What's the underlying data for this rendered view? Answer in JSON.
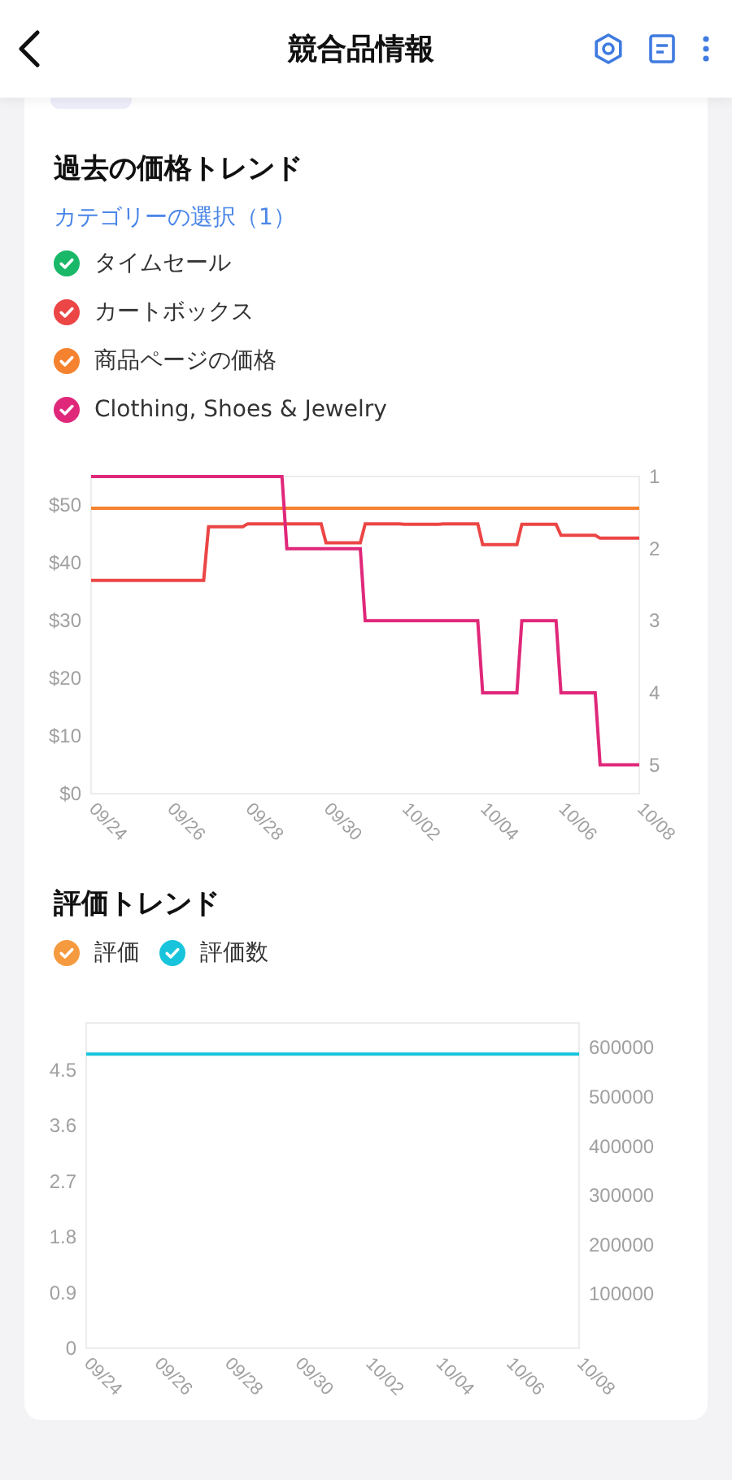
{
  "header": {
    "title": "競合品情報"
  },
  "sections": [
    {
      "title": "過去の価格トレンド",
      "link": "カテゴリーの選択（1）",
      "legend": [
        {
          "label": "タイムセール",
          "checked": true,
          "color": "#19b868"
        },
        {
          "label": "カートボックス",
          "checked": true,
          "color": "#ec4545"
        },
        {
          "label": "商品ページの価格",
          "checked": true,
          "color": "#f5822e"
        },
        {
          "label": "Clothing, Shoes & Jewelry",
          "checked": true,
          "color": "#e0287a"
        }
      ],
      "chart_data": {
        "type": "line",
        "categories": [
          "09/24",
          null,
          null,
          null,
          null,
          null,
          null,
          null,
          null,
          null,
          null,
          null,
          null,
          null,
          null,
          null,
          "09/26",
          null,
          null,
          null,
          null,
          null,
          null,
          null,
          null,
          null,
          null,
          null,
          null,
          null,
          null,
          null,
          "09/28",
          null,
          null,
          null,
          null,
          null,
          null,
          null,
          null,
          null,
          null,
          null,
          null,
          null,
          null,
          null,
          "09/30",
          null,
          null,
          null,
          null,
          null,
          null,
          null,
          null,
          null,
          null,
          null,
          null,
          null,
          null,
          null,
          "10/02",
          null,
          null,
          null,
          null,
          null,
          null,
          null,
          null,
          null,
          null,
          null,
          null,
          null,
          null,
          null,
          "10/04",
          null,
          null,
          null,
          null,
          null,
          null,
          null,
          null,
          null,
          null,
          null,
          null,
          null,
          null,
          null,
          "10/06",
          null,
          null,
          null,
          null,
          null,
          null,
          null,
          null,
          null,
          null,
          null,
          null,
          null,
          null,
          null,
          "10/08"
        ],
        "ylim": [
          0,
          55
        ],
        "yticks": [
          {
            "value": 0,
            "label": "$0"
          },
          {
            "value": 10,
            "label": "$10"
          },
          {
            "value": 20,
            "label": "$20"
          },
          {
            "value": 30,
            "label": "$30"
          },
          {
            "value": 40,
            "label": "$40"
          },
          {
            "value": 50,
            "label": "$50"
          }
        ],
        "y2lim": [
          5.4,
          1
        ],
        "y2ticks": [
          1,
          2,
          3,
          4,
          5
        ],
        "series": [
          {
            "color": "#f5822e",
            "values": [
              49.5,
              49.5,
              49.5,
              49.5,
              49.5,
              49.5,
              49.5,
              49.5,
              49.5,
              49.5,
              49.5,
              49.5,
              49.5,
              49.5,
              49.5,
              49.5,
              49.5,
              49.5,
              49.5,
              49.5,
              49.5,
              49.5,
              49.5,
              49.5,
              49.5,
              49.5,
              49.5,
              49.5,
              49.5,
              49.5,
              49.5,
              49.5,
              49.5,
              49.5,
              49.5,
              49.5,
              49.5,
              49.5,
              49.5,
              49.5,
              49.5,
              49.5,
              49.5,
              49.5,
              49.5,
              49.5,
              49.5,
              49.5,
              49.5,
              49.5,
              49.5,
              49.5,
              49.5,
              49.5,
              49.5,
              49.5,
              49.5,
              49.5,
              49.5,
              49.5,
              49.5,
              49.5,
              49.5,
              49.5,
              49.5,
              49.5,
              49.5,
              49.5,
              49.5,
              49.5,
              49.5,
              49.5,
              49.5,
              49.5,
              49.5,
              49.5,
              49.5,
              49.5,
              49.5,
              49.5,
              49.5,
              49.5,
              49.5,
              49.5,
              49.5,
              49.5,
              49.5,
              49.5,
              49.5,
              49.5,
              49.5,
              49.5,
              49.5,
              49.5,
              49.5,
              49.5,
              49.5,
              49.5,
              49.5,
              49.5,
              49.5,
              49.5,
              49.5,
              49.5,
              49.5,
              49.5,
              49.5,
              49.5,
              49.5,
              49.5,
              49.5,
              49.5,
              49.5
            ]
          },
          {
            "color": "#ec4545",
            "values": [
              37,
              37,
              37,
              37,
              37,
              37,
              37,
              37,
              37,
              37,
              37,
              37,
              37,
              37,
              37,
              37,
              37,
              37,
              37,
              37,
              37,
              37,
              37,
              37,
              46.3,
              46.3,
              46.3,
              46.3,
              46.3,
              46.3,
              46.3,
              46.3,
              46.8,
              46.8,
              46.8,
              46.8,
              46.8,
              46.8,
              46.8,
              46.8,
              46.8,
              46.8,
              46.8,
              46.8,
              46.8,
              46.8,
              46.8,
              46.8,
              43.5,
              43.5,
              43.5,
              43.5,
              43.5,
              43.5,
              43.5,
              43.5,
              46.8,
              46.8,
              46.8,
              46.8,
              46.8,
              46.8,
              46.8,
              46.8,
              46.7,
              46.7,
              46.7,
              46.7,
              46.7,
              46.7,
              46.7,
              46.7,
              46.8,
              46.8,
              46.8,
              46.8,
              46.8,
              46.8,
              46.8,
              46.8,
              43.2,
              43.2,
              43.2,
              43.2,
              43.2,
              43.2,
              43.2,
              43.2,
              46.7,
              46.7,
              46.7,
              46.7,
              46.7,
              46.7,
              46.7,
              46.7,
              44.8,
              44.8,
              44.8,
              44.8,
              44.8,
              44.8,
              44.8,
              44.8,
              44.3,
              44.3,
              44.3,
              44.3,
              44.3,
              44.3,
              44.3,
              44.3,
              44.3
            ]
          },
          {
            "color": "#e0287a",
            "axis": "y2",
            "values": [
              1,
              1,
              1,
              1,
              1,
              1,
              1,
              1,
              1,
              1,
              1,
              1,
              1,
              1,
              1,
              1,
              1,
              1,
              1,
              1,
              1,
              1,
              1,
              1,
              1,
              1,
              1,
              1,
              1,
              1,
              1,
              1,
              1,
              1,
              1,
              1,
              1,
              1,
              1,
              1,
              2,
              2,
              2,
              2,
              2,
              2,
              2,
              2,
              2,
              2,
              2,
              2,
              2,
              2,
              2,
              2,
              3,
              3,
              3,
              3,
              3,
              3,
              3,
              3,
              3,
              3,
              3,
              3,
              3,
              3,
              3,
              3,
              3,
              3,
              3,
              3,
              3,
              3,
              3,
              3,
              4,
              4,
              4,
              4,
              4,
              4,
              4,
              4,
              3,
              3,
              3,
              3,
              3,
              3,
              3,
              3,
              4,
              4,
              4,
              4,
              4,
              4,
              4,
              4,
              5,
              5,
              5,
              5,
              5,
              5,
              5,
              5,
              5
            ]
          }
        ]
      }
    },
    {
      "title": "評価トレンド",
      "legend": [
        {
          "label": "評価",
          "checked": true,
          "color": "#f59a3e"
        },
        {
          "label": "評価数",
          "checked": true,
          "color": "#17c4dc"
        }
      ],
      "chart_data": {
        "type": "line",
        "categories": [
          "09/24",
          null,
          "09/26",
          null,
          "09/28",
          null,
          "09/30",
          null,
          "10/02",
          null,
          "10/04",
          null,
          "10/06",
          null,
          "10/08"
        ],
        "ylim": [
          0,
          5.26
        ],
        "yticks": [
          0,
          0.9,
          1.8,
          2.7,
          3.6,
          4.5
        ],
        "y2lim": [
          -10000,
          650000
        ],
        "y2ticks": [
          100000,
          200000,
          300000,
          400000,
          500000,
          600000
        ],
        "series": [
          {
            "color": "#17c4dc",
            "axis": "y2",
            "values": [
              587000,
              587000,
              587000,
              587000,
              587000,
              587000,
              587000,
              587000,
              587000,
              587000,
              587000,
              587000,
              587000,
              587000,
              587000
            ]
          }
        ]
      }
    }
  ]
}
